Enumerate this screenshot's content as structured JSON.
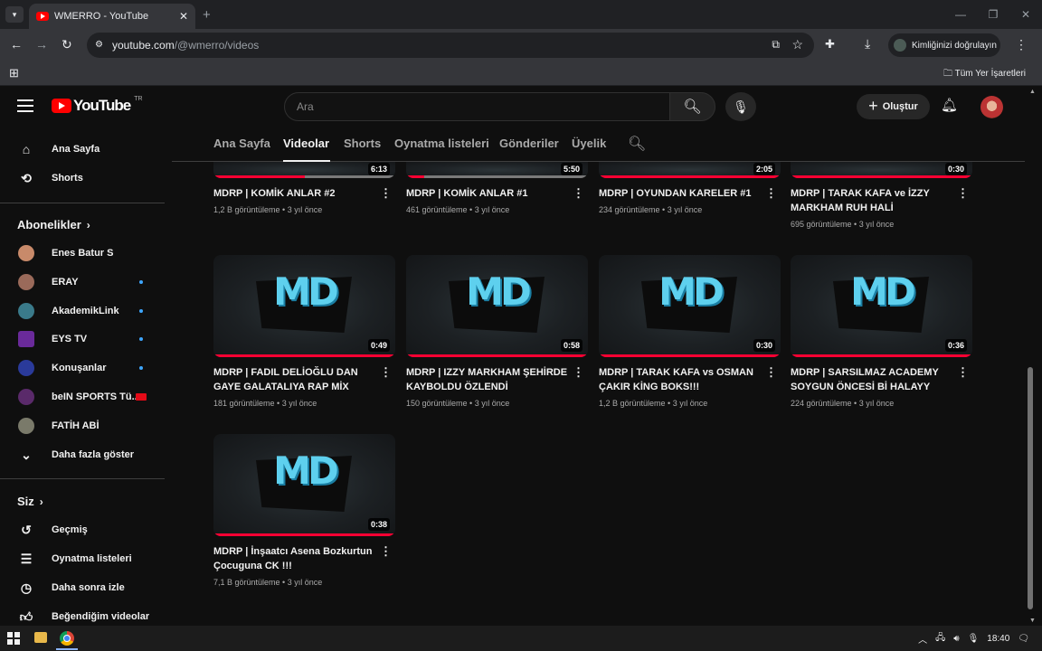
{
  "browser": {
    "tab_title": "WMERRO - YouTube",
    "new_tab": "+",
    "url_host": "youtube.com",
    "url_path": "/@wmerro/videos",
    "profile_label": "Kimliğinizi doğrulayın",
    "bookmarks_all": "Tüm Yer İşaretleri",
    "win_min": "—",
    "win_restore": "❐",
    "win_close": "✕"
  },
  "header": {
    "logo": "YouTube",
    "country": "TR",
    "search_placeholder": "Ara",
    "create": "Oluştur"
  },
  "sidebar": {
    "main": [
      {
        "label": "Ana Sayfa",
        "icon": "home-icon"
      },
      {
        "label": "Shorts",
        "icon": "shorts-icon"
      }
    ],
    "subs_title": "Abonelikler",
    "subscriptions": [
      {
        "label": "Enes Batur S",
        "color": "#c88a6a"
      },
      {
        "label": "ERAY",
        "color": "#9a6a5a"
      },
      {
        "label": "AkademikLink",
        "color": "#3a7a8a"
      },
      {
        "label": "EYS TV",
        "color": "#6a2a9a"
      },
      {
        "label": "Konuşanlar",
        "color": "#2a3a9a"
      },
      {
        "label": "beIN SPORTS Tü...",
        "color": "#5a2a6a"
      },
      {
        "label": "FATİH ABİ",
        "color": "#7a7a6a"
      }
    ],
    "show_more": "Daha fazla göster",
    "you_title": "Siz",
    "you_items": [
      {
        "label": "Geçmiş",
        "icon": "history-icon"
      },
      {
        "label": "Oynatma listeleri",
        "icon": "playlists-icon"
      },
      {
        "label": "Daha sonra izle",
        "icon": "watch-later-icon"
      },
      {
        "label": "Beğendiğim videolar",
        "icon": "liked-icon"
      }
    ]
  },
  "channel_tabs": [
    "Ana Sayfa",
    "Videolar",
    "Shorts",
    "Oynatma listeleri",
    "Gönderiler",
    "Üyelik"
  ],
  "active_tab": "Videolar",
  "thumbnail_logo": "MD",
  "videos_row1": [
    {
      "title": "MDRP | KOMİK ANLAR #2",
      "meta": "1,2 B görüntüleme • 3 yıl önce",
      "duration": "6:13",
      "progress": 0.5
    },
    {
      "title": "MDRP | KOMİK ANLAR #1",
      "meta": "461 görüntüleme • 3 yıl önce",
      "duration": "5:50",
      "progress": 0.1
    },
    {
      "title": "MDRP | OYUNDAN KARELER #1",
      "meta": "234 görüntüleme • 3 yıl önce",
      "duration": "2:05",
      "progress": 1
    },
    {
      "title": "MDRP | TARAK KAFA ve İZZY MARKHAM RUH HALİ",
      "meta": "695 görüntüleme • 3 yıl önce",
      "duration": "0:30",
      "progress": 1
    }
  ],
  "videos_row2": [
    {
      "title": "MDRP | FADIL DELİOĞLU DAN GAYE GALATALIYA RAP MİX",
      "meta": "181 görüntüleme • 3 yıl önce",
      "duration": "0:49"
    },
    {
      "title": "MDRP | IZZY MARKHAM ŞEHİRDE KAYBOLDU ÖZLENDİ",
      "meta": "150 görüntüleme • 3 yıl önce",
      "duration": "0:58"
    },
    {
      "title": "MDRP | TARAK KAFA vs OSMAN ÇAKIR KİNG BOKS!!!",
      "meta": "1,2 B görüntüleme • 3 yıl önce",
      "duration": "0:30"
    },
    {
      "title": "MDRP | SARSILMAZ ACADEMY SOYGUN ÖNCESİ Bİ HALAYY",
      "meta": "224 görüntüleme • 3 yıl önce",
      "duration": "0:36"
    }
  ],
  "videos_row3": [
    {
      "title": "MDRP | İnşaatcı Asena Bozkurtun Çocuguna CK !!!",
      "meta": "7,1 B görüntüleme • 3 yıl önce",
      "duration": "0:38"
    }
  ],
  "taskbar": {
    "time": "18:40"
  }
}
